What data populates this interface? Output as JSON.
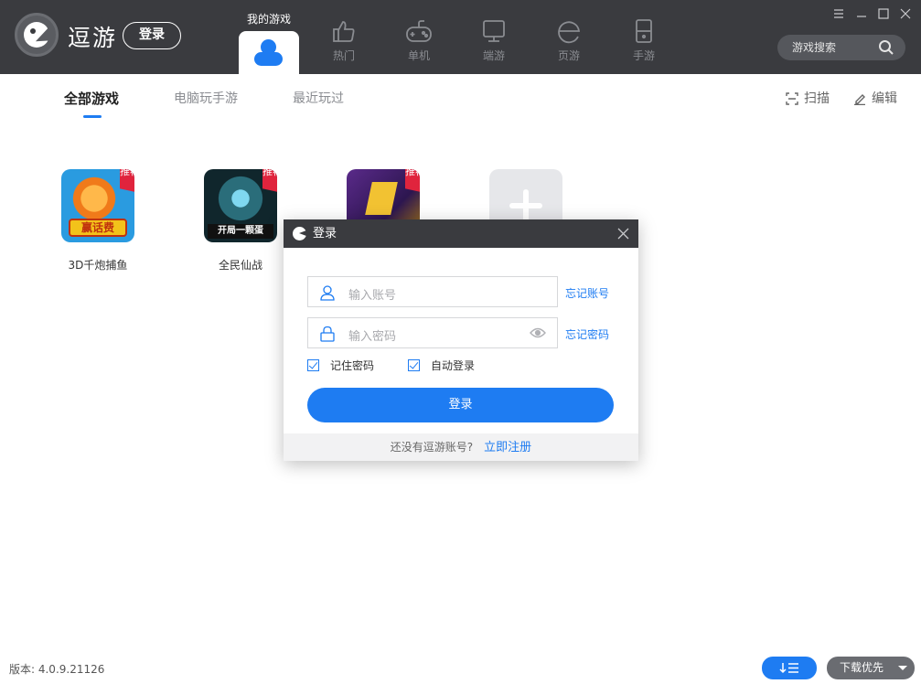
{
  "app": {
    "brand": "逗游",
    "login_button": "登录"
  },
  "nav": {
    "active_label": "我的游戏",
    "items": [
      {
        "label": "热门",
        "icon": "thumbs-up-icon"
      },
      {
        "label": "单机",
        "icon": "gamepad-icon"
      },
      {
        "label": "端游",
        "icon": "monitor-icon"
      },
      {
        "label": "页游",
        "icon": "browser-e-icon"
      },
      {
        "label": "手游",
        "icon": "phone-icon"
      }
    ]
  },
  "search": {
    "placeholder": "游戏搜索"
  },
  "subtabs": [
    {
      "label": "全部游戏",
      "active": true
    },
    {
      "label": "电脑玩手游",
      "active": false
    },
    {
      "label": "最近玩过",
      "active": false
    }
  ],
  "tools": {
    "scan": "扫描",
    "edit": "编辑"
  },
  "games": [
    {
      "name": "3D千炮捕鱼",
      "tag": "推荐",
      "banner": "赢话费"
    },
    {
      "name": "全民仙战",
      "tag": "推荐",
      "banner": "开局一颗蛋"
    },
    {
      "name": "",
      "tag": "推荐",
      "banner": ""
    }
  ],
  "login_dialog": {
    "title": "登录",
    "account_placeholder": "输入账号",
    "password_placeholder": "输入密码",
    "forgot_account": "忘记账号",
    "forgot_password": "忘记密码",
    "remember_password": "记住密码",
    "auto_login": "自动登录",
    "submit": "登录",
    "no_account_text": "还没有逗游账号?",
    "register_link": "立即注册"
  },
  "footer": {
    "version": "版本: 4.0.9.21126",
    "download_priority": "下载优先"
  },
  "colors": {
    "accent": "#1e7cf2",
    "topbar": "#3a3b3f",
    "tag_red": "#e0243d"
  }
}
